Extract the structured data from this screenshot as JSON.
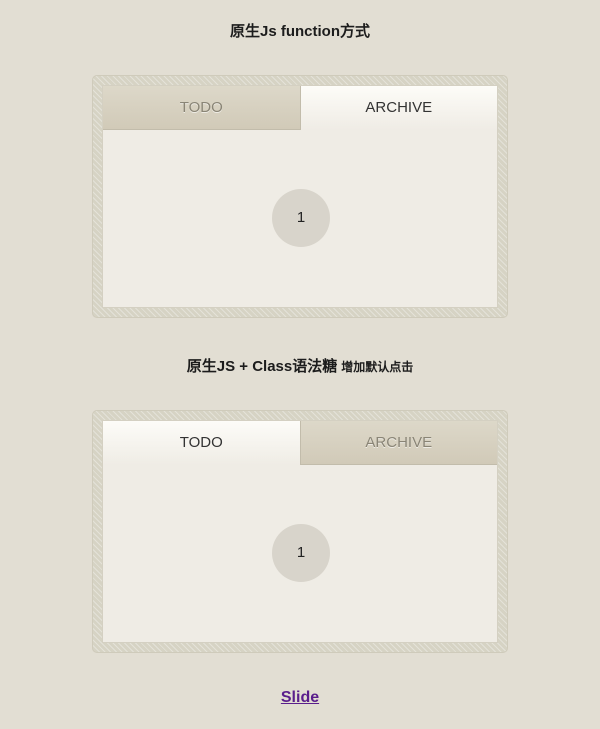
{
  "section1": {
    "title": "原生Js function方式",
    "tabs": [
      {
        "label": "TODO",
        "active": false
      },
      {
        "label": "ARCHIVE",
        "active": true
      }
    ],
    "content": "1"
  },
  "section2": {
    "title": "原生JS + Class语法糖",
    "title_note": "增加默认点击",
    "tabs": [
      {
        "label": "TODO",
        "active": true
      },
      {
        "label": "ARCHIVE",
        "active": false
      }
    ],
    "content": "1"
  },
  "footer": {
    "link_label": "Slide"
  },
  "colors": {
    "background": "#e2ded3",
    "panel": "#efece5",
    "inactive_tab": "#d6d0bf",
    "link": "#5a1e8c"
  }
}
